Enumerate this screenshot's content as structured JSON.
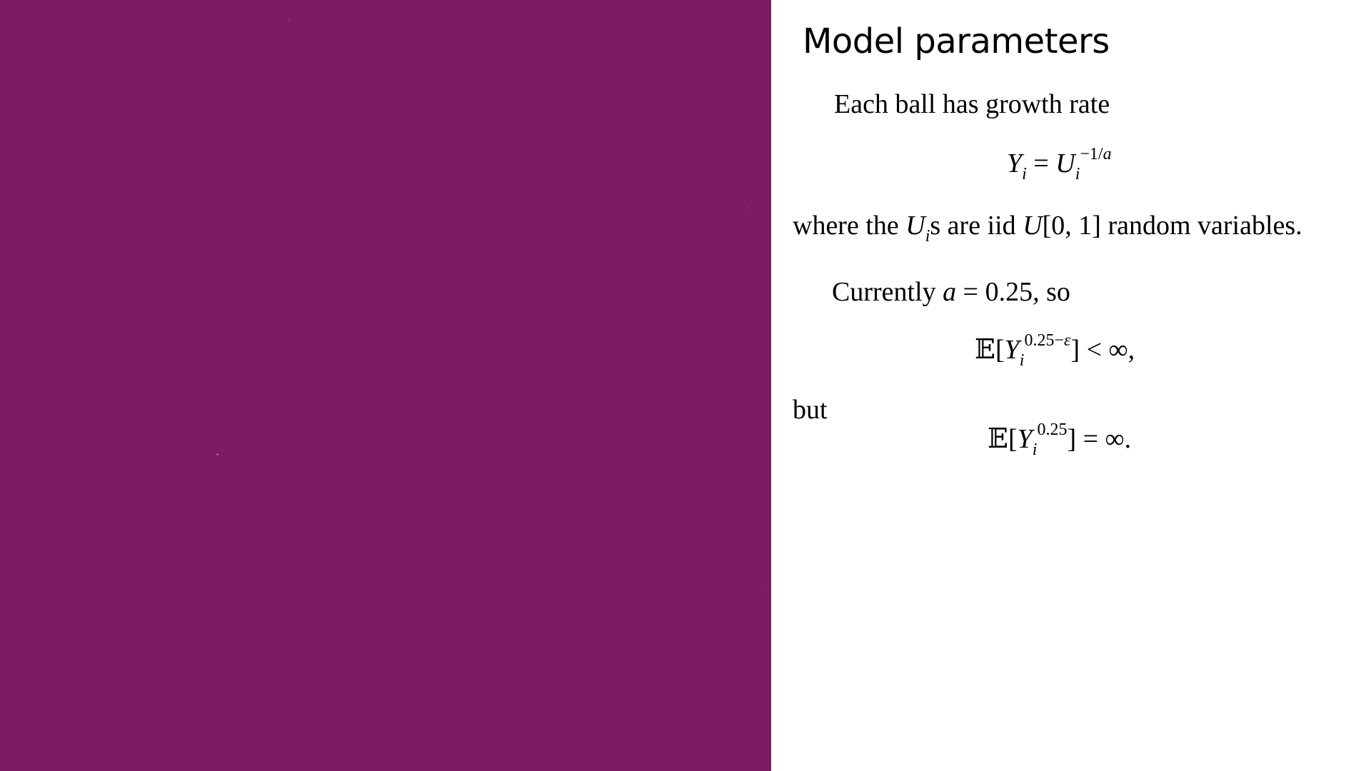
{
  "slide": {
    "title": "Model parameters",
    "intro": "Each ball has growth rate",
    "where_text": "where the Uis are iid U[0, 1] random variables.",
    "currently_text": "Currently a = 0.25, so",
    "but_text": "but",
    "equations": {
      "growth": "Yi = Ui^(−1/a)",
      "finite": "E[Yi^(0.25−ε)] < ∞,",
      "infinite": "E[Yi^0.25] = ∞."
    }
  },
  "colors": {
    "canvas_background": "#7e1b65",
    "text_panel_background": "#ffffff",
    "speck_highlight": "#e0409e"
  }
}
